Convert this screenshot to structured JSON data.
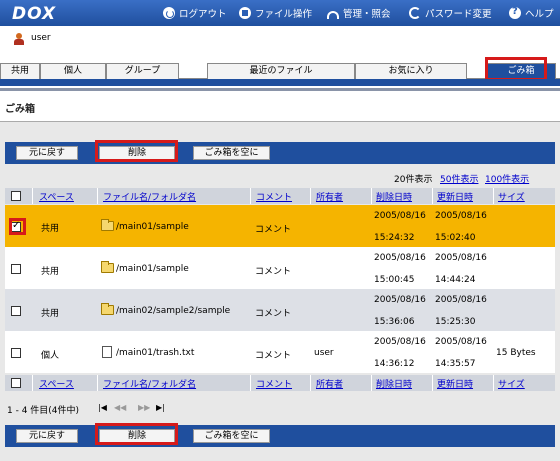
{
  "header": {
    "logo": "DOX",
    "nav": [
      {
        "label": "ログアウト",
        "icon": "logout-icon"
      },
      {
        "label": "ファイル操作",
        "icon": "file-operation-icon"
      },
      {
        "label": "管理・照会",
        "icon": "admin-icon"
      },
      {
        "label": "パスワード変更",
        "icon": "password-change-icon"
      },
      {
        "label": "ヘルプ",
        "icon": "help-icon"
      }
    ]
  },
  "user": {
    "name": "user"
  },
  "tabs": [
    "共用",
    "個人",
    "グループ",
    "最近のファイル",
    "お気に入り",
    "ごみ箱"
  ],
  "page": {
    "title": "ごみ箱"
  },
  "buttons": {
    "restore": "元に戻す",
    "delete": "削除",
    "empty": "ごみ箱を空に"
  },
  "pager": {
    "show20": "20件表示",
    "show50": "50件表示",
    "show100": "100件表示"
  },
  "columns": [
    "スペース",
    "ファイル名/フォルダ名",
    "コメント",
    "所有者",
    "削除日時",
    "更新日時",
    "サイズ"
  ],
  "rows": [
    {
      "space": "共用",
      "name": "/main01/sample",
      "type": "folder",
      "comment": "コメント",
      "owner": "",
      "deleted_date": "2005/08/16",
      "deleted_time": "15:24:32",
      "updated_date": "2005/08/16",
      "updated_time": "15:02:40",
      "size": "",
      "checked": true
    },
    {
      "space": "共用",
      "name": "/main01/sample",
      "type": "folder",
      "comment": "コメント",
      "owner": "",
      "deleted_date": "2005/08/16",
      "deleted_time": "15:00:45",
      "updated_date": "2005/08/16",
      "updated_time": "14:44:24",
      "size": "",
      "checked": false
    },
    {
      "space": "共用",
      "name": "/main02/sample2/sample",
      "type": "folder",
      "comment": "コメント",
      "owner": "",
      "deleted_date": "2005/08/16",
      "deleted_time": "15:36:06",
      "updated_date": "2005/08/16",
      "updated_time": "15:25:30",
      "size": "",
      "checked": false
    },
    {
      "space": "個人",
      "name": "/main01/trash.txt",
      "type": "file",
      "comment": "コメント",
      "owner": "user",
      "deleted_date": "2005/08/16",
      "deleted_time": "14:36:12",
      "updated_date": "2005/08/16",
      "updated_time": "14:35:57",
      "size": "15 Bytes",
      "checked": false
    }
  ],
  "footer": {
    "count": "1 - 4 件目(4件中)"
  },
  "colors": {
    "header_blue": "#1f4f9e",
    "selected_row": "#f5b400",
    "highlight_red": "#d61a1a"
  }
}
